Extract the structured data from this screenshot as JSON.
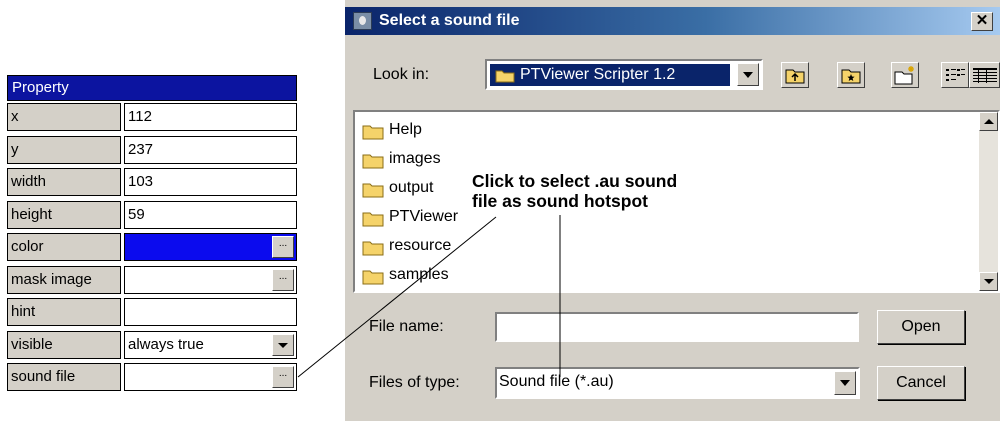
{
  "property_panel": {
    "header": "Property",
    "rows": [
      {
        "name": "x",
        "value": "112"
      },
      {
        "name": "y",
        "value": "237"
      },
      {
        "name": "width",
        "value": "103"
      },
      {
        "name": "height",
        "value": "59"
      },
      {
        "name": "color",
        "value": ""
      },
      {
        "name": "mask image",
        "value": ""
      },
      {
        "name": "hint",
        "value": ""
      },
      {
        "name": "visible",
        "value": "always true"
      },
      {
        "name": "sound file",
        "value": ""
      }
    ],
    "color_value_hex": "#0b0bee",
    "ellipsis_label": "...",
    "icons": {
      "dropdown": "chevron-down-icon"
    }
  },
  "dialog": {
    "title": "Select a sound file",
    "close_label": "✕",
    "look_in_label": "Look in:",
    "look_in_value": "PTViewer Scripter 1.2",
    "toolbar_icons": [
      "up-one-level-icon",
      "desktop-icon",
      "new-folder-icon",
      "list-view-icon",
      "details-view-icon"
    ],
    "files": [
      "Help",
      "images",
      "output",
      "PTViewer",
      "resource",
      "samples"
    ],
    "file_name_label": "File name:",
    "file_name_value": "",
    "files_of_type_label": "Files of type:",
    "files_of_type_value": "Sound file (*.au)",
    "open_button": "Open",
    "cancel_button": "Cancel",
    "colors": {
      "titlebar_start": "#0a246a",
      "titlebar_end": "#a6caf0",
      "selection": "#0a246a",
      "folder": "#f5d36a"
    }
  },
  "annotation": {
    "text": "Click to select .au sound\nfile as sound hotspot"
  }
}
